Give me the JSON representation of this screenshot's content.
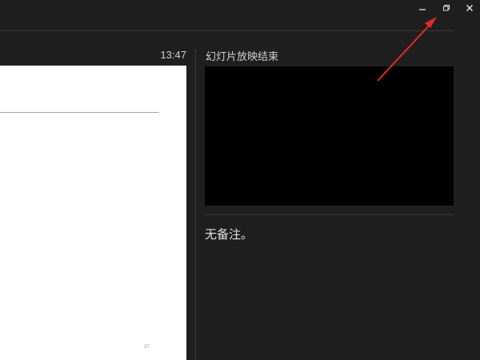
{
  "window": {
    "controls": {
      "minimize_icon": "minimize-icon",
      "restore_icon": "restore-icon",
      "close_icon": "close-icon"
    }
  },
  "current_slide": {
    "time": "13:47",
    "page_number": "37"
  },
  "next_slide": {
    "label": "幻灯片放映结束"
  },
  "notes": {
    "text": "无备注。"
  },
  "annotation": {
    "color": "#e02a2a",
    "points_to": "restore-button"
  },
  "colors": {
    "background": "#1f1f1f",
    "divider": "#3a3a3a",
    "slide_background": "#ffffff",
    "next_preview_background": "#000000"
  }
}
